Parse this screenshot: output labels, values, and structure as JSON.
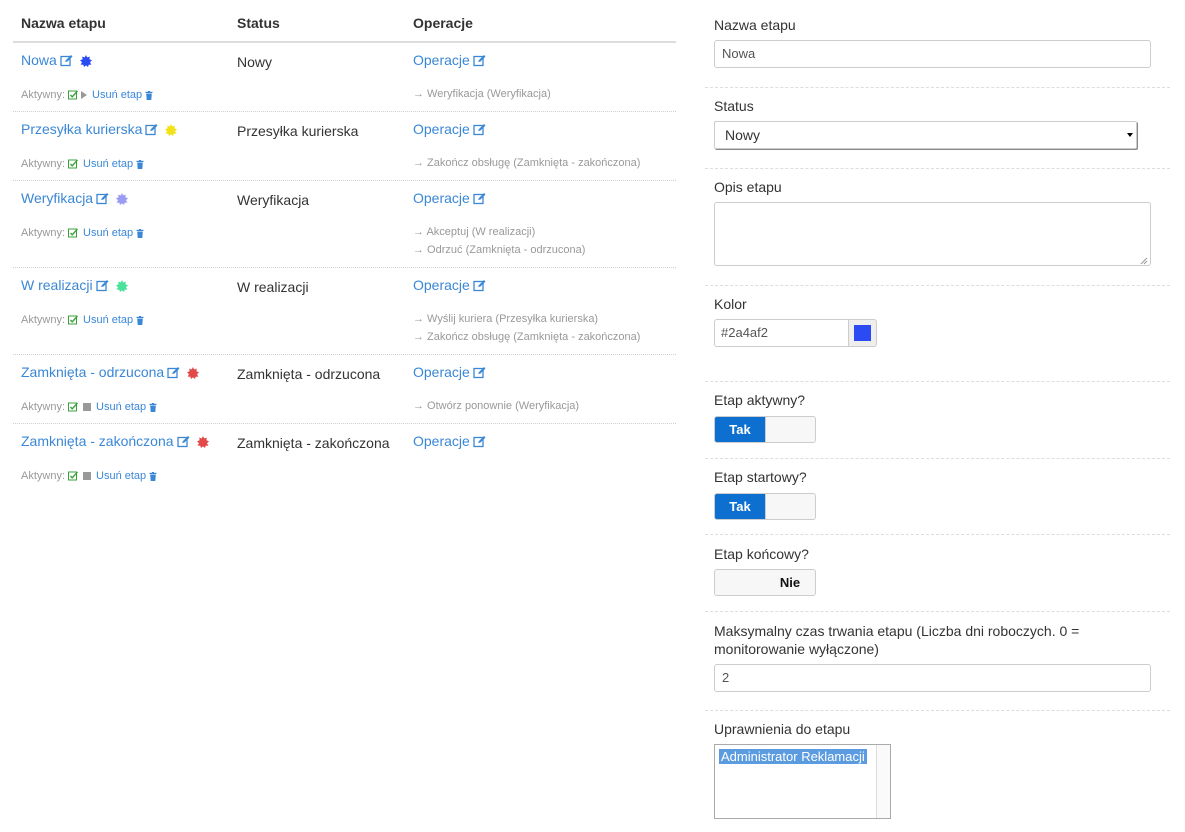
{
  "table": {
    "headers": {
      "name": "Nazwa etapu",
      "status": "Status",
      "ops": "Operacje"
    },
    "active_label": "Aktywny:",
    "delete_label": "Usuń etap",
    "ops_label": "Operacje",
    "stages": [
      {
        "name": "Nowa",
        "status": "Nowy",
        "color": "#2a4af2",
        "start_icon": "play-icon",
        "transitions": [
          "→ Weryfikacja (Weryfikacja)"
        ]
      },
      {
        "name": "Przesyłka kurierska",
        "status": "Przesyłka kurierska",
        "color": "#f2e21a",
        "start_icon": "",
        "transitions": [
          "→ Zakończ obsługę (Zamknięta - zakończona)"
        ]
      },
      {
        "name": "Weryfikacja",
        "status": "Weryfikacja",
        "color": "#9a9cf2",
        "start_icon": "",
        "transitions": [
          "→ Akceptuj (W realizacji)",
          "→ Odrzuć (Zamknięta - odrzucona)"
        ]
      },
      {
        "name": "W realizacji",
        "status": "W realizacji",
        "color": "#4ae29a",
        "start_icon": "",
        "transitions": [
          "→ Wyślij kuriera (Przesyłka kurierska)",
          "→ Zakończ obsługę (Zamknięta - zakończona)"
        ]
      },
      {
        "name": "Zamknięta - odrzucona",
        "status": "Zamknięta - odrzucona",
        "color": "#e24a4a",
        "start_icon": "stop-icon",
        "transitions": [
          "→ Otwórz ponownie (Weryfikacja)"
        ]
      },
      {
        "name": "Zamknięta - zakończona",
        "status": "Zamknięta - zakończona",
        "color": "#e24a4a",
        "start_icon": "stop-icon",
        "transitions": []
      }
    ]
  },
  "form": {
    "name_label": "Nazwa etapu",
    "name_value": "Nowa",
    "status_label": "Status",
    "status_value": "Nowy",
    "desc_label": "Opis etapu",
    "desc_value": "",
    "color_label": "Kolor",
    "color_value": "#2a4af2",
    "active_label": "Etap aktywny?",
    "active_value": "Tak",
    "start_label": "Etap startowy?",
    "start_value": "Tak",
    "end_label": "Etap końcowy?",
    "end_value": "Nie",
    "maxtime_label": "Maksymalny czas trwania etapu (Liczba dni roboczych. 0 = monitorowanie wyłączone)",
    "maxtime_value": "2",
    "perm_label": "Uprawnienia do etapu",
    "perm_options": [
      "Administrator Reklamacji"
    ]
  }
}
